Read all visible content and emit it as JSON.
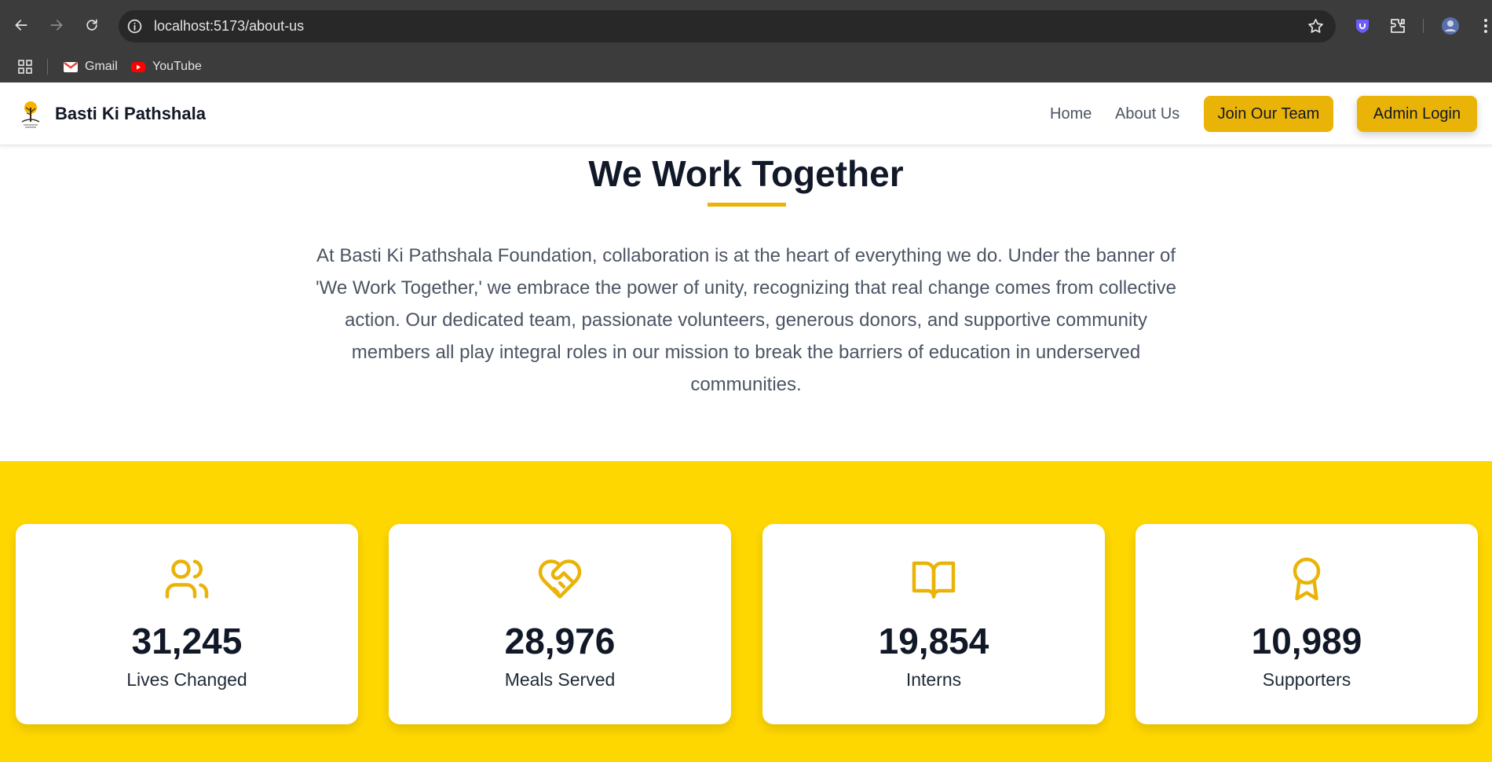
{
  "browser": {
    "url": "localhost:5173/about-us",
    "bookmarks": [
      {
        "label": "Gmail",
        "icon": "gmail-icon"
      },
      {
        "label": "YouTube",
        "icon": "youtube-icon"
      }
    ]
  },
  "header": {
    "brand": "Basti Ki Pathshala",
    "nav": {
      "home": "Home",
      "about": "About Us",
      "join": "Join Our Team",
      "admin": "Admin Login"
    }
  },
  "intro": {
    "title": "We Work Together",
    "body": "At Basti Ki Pathshala Foundation, collaboration is at the heart of everything we do. Under the banner of 'We Work Together,' we embrace the power of unity, recognizing that real change comes from collective action. Our dedicated team, passionate volunteers, generous donors, and supportive community members all play integral roles in our mission to break the barriers of education in underserved communities."
  },
  "stats": [
    {
      "value": "31,245",
      "label": "Lives Changed",
      "icon": "users-icon"
    },
    {
      "value": "28,976",
      "label": "Meals Served",
      "icon": "handshake-heart-icon"
    },
    {
      "value": "19,854",
      "label": "Interns",
      "icon": "open-book-icon"
    },
    {
      "value": "10,989",
      "label": "Supporters",
      "icon": "award-ribbon-icon"
    }
  ],
  "colors": {
    "accent": "#eab308",
    "band": "#ffd700",
    "text_dark": "#111827",
    "text_muted": "#4b5563"
  }
}
